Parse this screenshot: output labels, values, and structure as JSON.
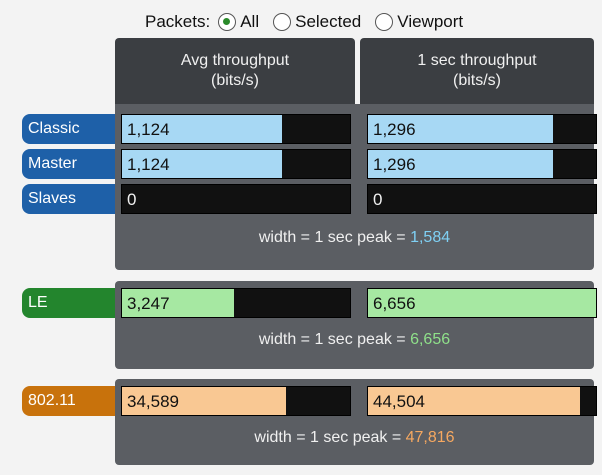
{
  "packets_filter": {
    "label": "Packets:",
    "options": [
      {
        "label": "All",
        "selected": true
      },
      {
        "label": "Selected",
        "selected": false
      },
      {
        "label": "Viewport",
        "selected": false
      }
    ]
  },
  "columns": [
    {
      "line1": "Avg throughput",
      "line2": "(bits/s)"
    },
    {
      "line1": "1 sec throughput",
      "line2": "(bits/s)"
    }
  ],
  "groups": [
    {
      "color": "#1e60a8",
      "rows": [
        {
          "label": "Classic",
          "avg": "1,124",
          "avg_fill": 0.7,
          "sec": "1,296",
          "sec_fill": 0.81
        },
        {
          "label": "Master",
          "avg": "1,124",
          "avg_fill": 0.7,
          "sec": "1,296",
          "sec_fill": 0.81
        },
        {
          "label": "Slaves",
          "avg": "0",
          "avg_fill": 0,
          "sec": "0",
          "sec_fill": 0
        }
      ],
      "peak_text": "width = 1 sec peak = ",
      "peak_value": "1,584"
    },
    {
      "color": "#23852d",
      "rows": [
        {
          "label": "LE",
          "avg": "3,247",
          "avg_fill": 0.49,
          "sec": "6,656",
          "sec_fill": 1.0
        }
      ],
      "peak_text": "width = 1 sec peak = ",
      "peak_value": "6,656"
    },
    {
      "color": "#c8720c",
      "rows": [
        {
          "label": "802.11",
          "avg": "34,589",
          "avg_fill": 0.72,
          "sec": "44,504",
          "sec_fill": 0.93
        }
      ],
      "peak_text": "width = 1 sec peak = ",
      "peak_value": "47,816"
    }
  ]
}
